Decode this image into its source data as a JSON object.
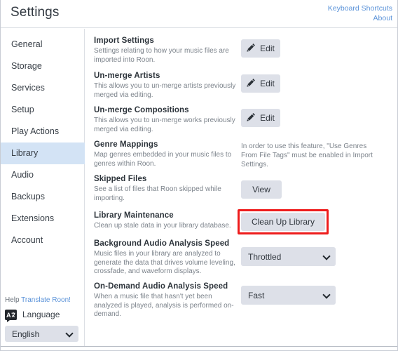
{
  "header": {
    "title": "Settings",
    "links": [
      {
        "label": "Keyboard Shortcuts",
        "name": "keyboard-shortcuts-link"
      },
      {
        "label": "About",
        "name": "about-link"
      }
    ]
  },
  "sidebar": {
    "items": [
      {
        "label": "General",
        "active": false
      },
      {
        "label": "Storage",
        "active": false
      },
      {
        "label": "Services",
        "active": false
      },
      {
        "label": "Setup",
        "active": false
      },
      {
        "label": "Play Actions",
        "active": false
      },
      {
        "label": "Library",
        "active": true
      },
      {
        "label": "Audio",
        "active": false
      },
      {
        "label": "Backups",
        "active": false
      },
      {
        "label": "Extensions",
        "active": false
      },
      {
        "label": "Account",
        "active": false
      }
    ],
    "footer": {
      "help_prefix": "Help ",
      "translate_link": "Translate Roon!",
      "language_icon": "translate-icon",
      "language_label": "Language",
      "language_value": "English"
    }
  },
  "main": {
    "sections": [
      {
        "title": "Import Settings",
        "desc": "Settings relating to how your music files are imported into Roon.",
        "control": {
          "type": "button",
          "label": "Edit",
          "icon": "pencil-icon"
        }
      },
      {
        "title": "Un-merge Artists",
        "desc": "This allows you to un-merge artists previously merged via editing.",
        "control": {
          "type": "button",
          "label": "Edit",
          "icon": "pencil-icon"
        }
      },
      {
        "title": "Un-merge Compositions",
        "desc": "This allows you to un-merge works previously merged via editing.",
        "control": {
          "type": "button",
          "label": "Edit",
          "icon": "pencil-icon"
        }
      },
      {
        "title": "Genre Mappings",
        "desc": "Map genres embedded in your music files to genres within Roon.",
        "control": {
          "type": "note",
          "label": "In order to use this feature, \"Use Genres From File Tags\" must be enabled in Import Settings."
        }
      },
      {
        "title": "Skipped Files",
        "desc": "See a list of files that Roon skipped while importing.",
        "control": {
          "type": "button",
          "label": "View"
        }
      },
      {
        "title": "Library Maintenance",
        "desc": "Clean up stale data in your library database.",
        "control": {
          "type": "button",
          "label": "Clean Up Library",
          "highlighted": true
        }
      },
      {
        "title": "Background Audio Analysis Speed",
        "desc": "Music files in your library are analyzed to generate the data that drives volume leveling, crossfade, and waveform displays.",
        "control": {
          "type": "select",
          "value": "Throttled"
        }
      },
      {
        "title": "On-Demand Audio Analysis Speed",
        "desc": "When a music file that hasn't yet been analyzed is played, analysis is performed on-demand.",
        "control": {
          "type": "select",
          "value": "Fast"
        }
      }
    ]
  },
  "colors": {
    "accent_link": "#5b93d9",
    "sidebar_active": "#d3e3f5",
    "button_bg": "#dde0e8",
    "highlight_annotation": "#ee1c1c"
  }
}
